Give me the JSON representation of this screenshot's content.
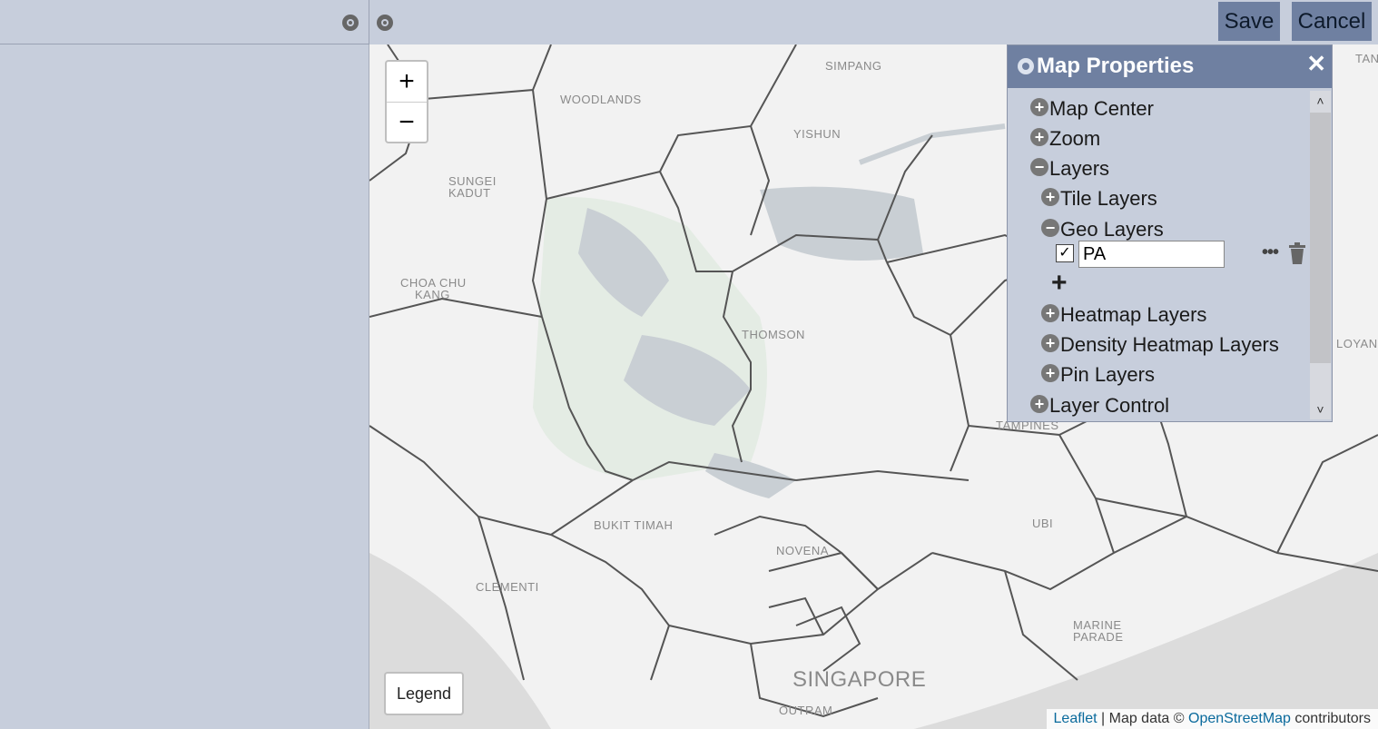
{
  "toolbar": {
    "left_settings_icon": "gear-icon",
    "right_settings_icon": "gear-icon",
    "save_label": "Save",
    "cancel_label": "Cancel"
  },
  "map": {
    "zoom_in_label": "+",
    "zoom_out_label": "−",
    "legend_label": "Legend",
    "attribution": {
      "leaflet": "Leaflet",
      "separator": " | Map data © ",
      "osm": "OpenStreetMap",
      "suffix": " contributors"
    },
    "place_labels": [
      "SIMPANG",
      "WOODLANDS",
      "YISHUN",
      "SUNGEI",
      "KADUT",
      "CHOA CHU",
      "KANG",
      "THOMSON",
      "BUKIT TIMAH",
      "NOVENA",
      "CLEMENTI",
      "UBI",
      "MARINE",
      "PARADE",
      "SINGAPORE",
      "OUTRAM",
      "TAMPINES",
      "LOYAN",
      "TAN"
    ]
  },
  "map_properties": {
    "title": "Map Properties",
    "close_icon": "close-icon",
    "items": [
      {
        "label": "Map Center",
        "state": "collapsed"
      },
      {
        "label": "Zoom",
        "state": "collapsed"
      },
      {
        "label": "Layers",
        "state": "expanded"
      },
      {
        "label": "Tile Layers",
        "state": "collapsed"
      },
      {
        "label": "Geo Layers",
        "state": "expanded"
      },
      {
        "label": "Heatmap Layers",
        "state": "collapsed"
      },
      {
        "label": "Density Heatmap Layers",
        "state": "collapsed"
      },
      {
        "label": "Pin Layers",
        "state": "collapsed"
      },
      {
        "label": "Layer Control",
        "state": "collapsed"
      }
    ],
    "geo_layer": {
      "checked": true,
      "name": "PA"
    },
    "add_label": "+",
    "more_icon": "more-icon",
    "delete_icon": "trash-icon"
  },
  "colors": {
    "accent": "#6f80a1",
    "panel": "#c7cedc"
  }
}
